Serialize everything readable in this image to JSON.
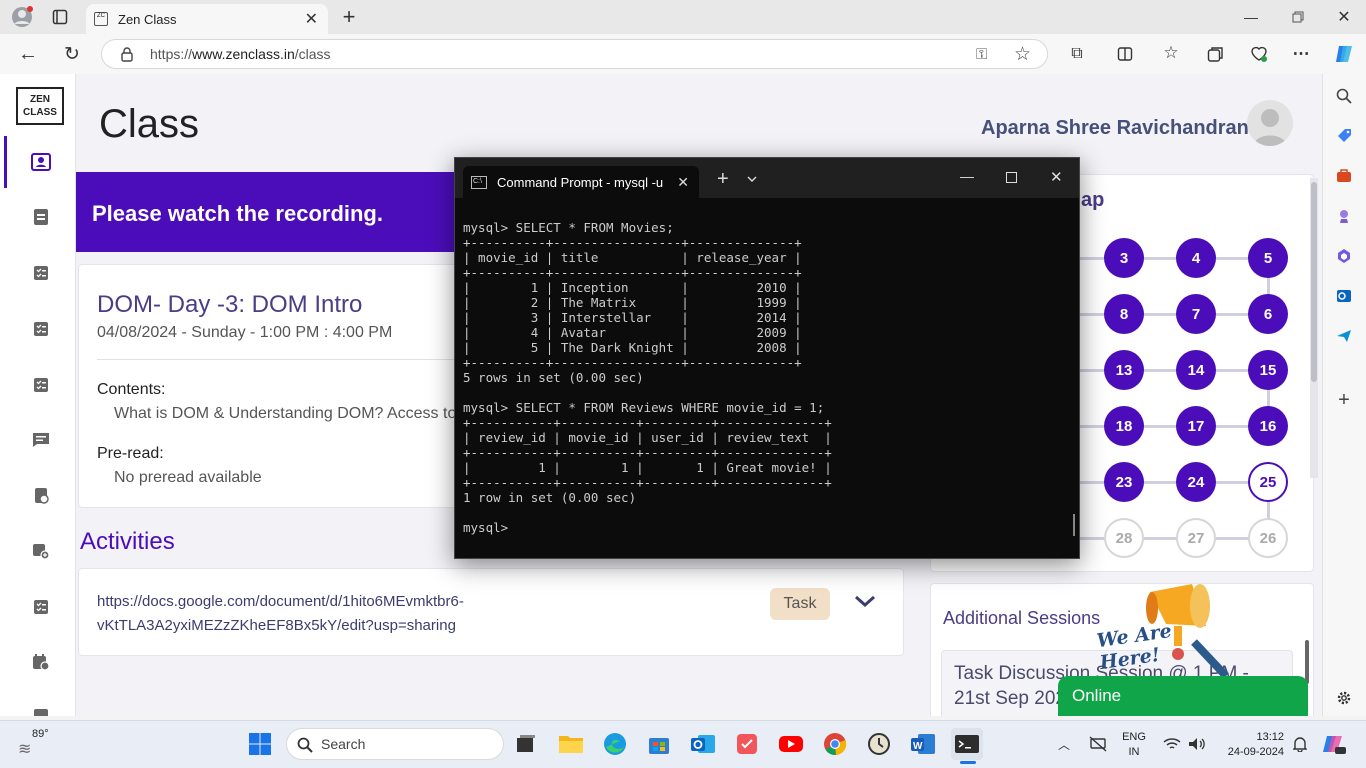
{
  "browser": {
    "tab_title": "Zen Class",
    "url_prefix": "https://",
    "url_host": "www.zenclass.in",
    "url_path": "/class"
  },
  "page": {
    "logo_line1": "ZEN",
    "logo_line2": "CLASS",
    "title": "Class",
    "user_name": "Aparna Shree Ravichandran",
    "banner": "Please watch the recording.",
    "session_title": "DOM- Day -3: DOM Intro",
    "session_time": "04/08/2024 - Sunday - 1:00 PM : 4:00 PM",
    "contents_label": "Contents:",
    "contents_text": "What is DOM & Understanding DOM? Access to",
    "preread_label": "Pre-read:",
    "preread_text": "No preread available",
    "activities_label": "Activities",
    "activity_link_line1": "https://docs.google.com/document/d/1hito6MEvmktbr6-",
    "activity_link_line2": "vKtTLA3A2yxiMEZzZKheEF8Bx5kY/edit?usp=sharing",
    "task_badge": "Task",
    "roadmap_heading_fragment": "ap",
    "roadmap_rows": [
      [
        "3",
        "4",
        "5"
      ],
      [
        "8",
        "7",
        "6"
      ],
      [
        "13",
        "14",
        "15"
      ],
      [
        "18",
        "17",
        "16"
      ],
      [
        "23",
        "24",
        "25"
      ],
      [
        "28",
        "27",
        "26"
      ]
    ],
    "additional_sessions_label": "Additional Sessions",
    "session_item_line1": "Task Discussion Session @ 1 PM -",
    "session_item_line2": "21st Sep 202",
    "we_are_here": "We Are Here!",
    "online_label": "Online"
  },
  "terminal": {
    "tab_title": "Command Prompt - mysql  -u",
    "lines": [
      "mysql> SELECT * FROM Movies;",
      "+----------+-----------------+--------------+",
      "| movie_id | title           | release_year |",
      "+----------+-----------------+--------------+",
      "|        1 | Inception       |         2010 |",
      "|        2 | The Matrix      |         1999 |",
      "|        3 | Interstellar    |         2014 |",
      "|        4 | Avatar          |         2009 |",
      "|        5 | The Dark Knight |         2008 |",
      "+----------+-----------------+--------------+",
      "5 rows in set (0.00 sec)",
      "",
      "mysql> SELECT * FROM Reviews WHERE movie_id = 1;",
      "+-----------+----------+---------+--------------+",
      "| review_id | movie_id | user_id | review_text  |",
      "+-----------+----------+---------+--------------+",
      "|         1 |        1 |       1 | Great movie! |",
      "+-----------+----------+---------+--------------+",
      "1 row in set (0.00 sec)",
      "",
      "mysql>"
    ]
  },
  "taskbar": {
    "weather": "89°",
    "search_placeholder": "Search",
    "lang_line1": "ENG",
    "lang_line2": "IN",
    "time": "13:12",
    "date": "24-09-2024"
  },
  "colors": {
    "accent": "#4b0dba",
    "online": "#0fa548",
    "terminal_bg": "#0c0c0c"
  }
}
